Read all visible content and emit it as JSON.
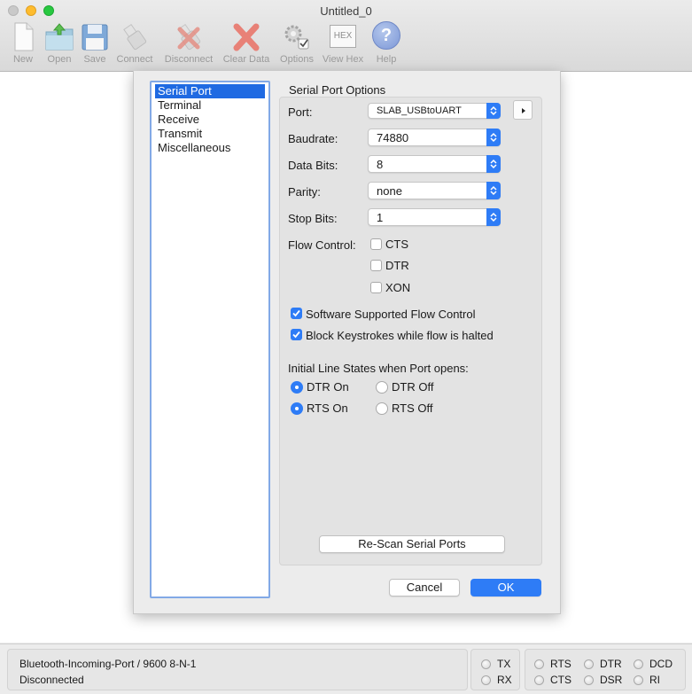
{
  "window": {
    "title": "Untitled_0"
  },
  "toolbar": {
    "new": "New",
    "open": "Open",
    "save": "Save",
    "connect": "Connect",
    "disconnect": "Disconnect",
    "clear_data": "Clear Data",
    "options": "Options",
    "view_hex": "View Hex",
    "hex_glyph": "HEX",
    "help": "Help",
    "help_glyph": "?"
  },
  "sidebar": {
    "items": [
      {
        "label": "Serial Port",
        "selected": true
      },
      {
        "label": "Terminal"
      },
      {
        "label": "Receive"
      },
      {
        "label": "Transmit"
      },
      {
        "label": "Miscellaneous"
      }
    ]
  },
  "options": {
    "heading": "Serial Port Options",
    "port": {
      "label": "Port:",
      "value": "SLAB_USBtoUART"
    },
    "baudrate": {
      "label": "Baudrate:",
      "value": "74880"
    },
    "data_bits": {
      "label": "Data Bits:",
      "value": "8"
    },
    "parity": {
      "label": "Parity:",
      "value": "none"
    },
    "stop_bits": {
      "label": "Stop Bits:",
      "value": "1"
    },
    "flow_control": {
      "label": "Flow Control:",
      "cts": {
        "label": "CTS",
        "checked": false
      },
      "dtr": {
        "label": "DTR",
        "checked": false
      },
      "xon": {
        "label": "XON",
        "checked": false
      }
    },
    "software_flow": {
      "label": "Software Supported Flow Control",
      "checked": true
    },
    "block_keystrokes": {
      "label": "Block Keystrokes while flow is halted",
      "checked": true
    },
    "initial_states": {
      "heading": "Initial Line States when Port opens:",
      "dtr_on": "DTR On",
      "dtr_off": "DTR Off",
      "rts_on": "RTS On",
      "rts_off": "RTS Off",
      "dtr_selected": "DTR On",
      "rts_selected": "RTS On"
    },
    "rescan": "Re-Scan Serial Ports"
  },
  "dialog_buttons": {
    "cancel": "Cancel",
    "ok": "OK"
  },
  "status": {
    "line1": "Bluetooth-Incoming-Port / 9600 8-N-1",
    "line2": "Disconnected",
    "leds": {
      "tx": "TX",
      "rx": "RX",
      "rts": "RTS",
      "cts": "CTS",
      "dtr": "DTR",
      "dsr": "DSR",
      "dcd": "DCD",
      "ri": "RI"
    }
  },
  "colors": {
    "accent": "#2e7cf6",
    "selection": "#1f6ae2",
    "close": "#fe5f57",
    "minimize": "#febc2e",
    "zoom": "#28c840"
  }
}
